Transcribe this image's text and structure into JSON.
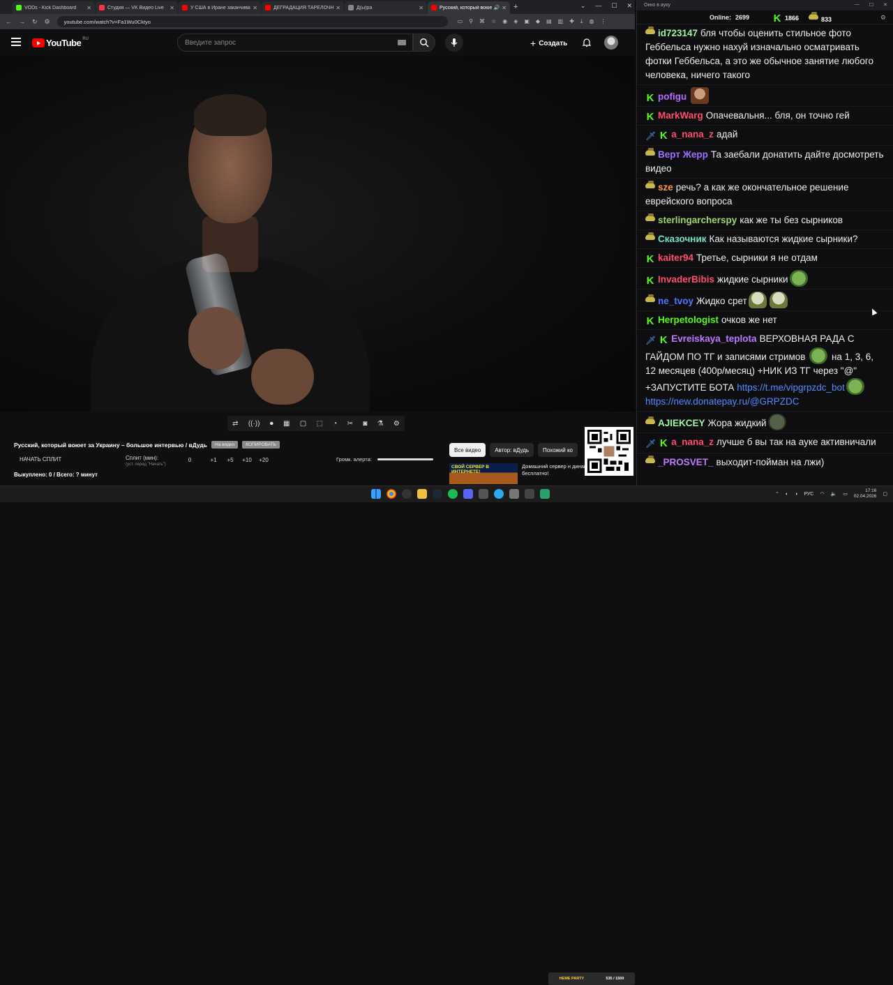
{
  "browser": {
    "tabs": [
      {
        "title": "VODs - Kick Dashboard",
        "color": "#53fc18"
      },
      {
        "title": "Студия — VK Видео Live",
        "color": "#ff3347"
      },
      {
        "title": "У США в Иране заканчивают",
        "color": "#ff0000"
      },
      {
        "title": "ДЕГРАДАЦИЯ ТАРЕЛОЧНИЦ",
        "color": "#ff0000"
      },
      {
        "title": "Д(ы)ра",
        "color": "#888888"
      },
      {
        "title": "Русский, который воюет з",
        "color": "#ff0000"
      }
    ],
    "url": "youtube.com/watch?v=Fa1Wu0Cktyo"
  },
  "youtube": {
    "logo": "YouTube",
    "region": "RU",
    "search_placeholder": "Введите запрос",
    "create_label": "Создать"
  },
  "player": {
    "toolbar_icons": [
      "loop-icon",
      "broadcast-icon",
      "screen-record-icon",
      "filmstrip-icon",
      "picture-in-picture-icon",
      "frame-icon",
      "speed-icon",
      "snippet-icon",
      "camera-icon",
      "flask-icon",
      "gear-icon"
    ]
  },
  "video": {
    "title": "Русский, который воюет за Украину – большое интервью / вДудь",
    "btn_on_video": "На видео",
    "btn_copy": "КОПИРОВАТЬ"
  },
  "split": {
    "start_label": "НАЧАТЬ СПЛИТ",
    "minutes_label": "Сплит (мин):",
    "minutes_sub": "(уст. перед \"Начать\")",
    "value": "0",
    "steps": [
      "+1",
      "+5",
      "+10",
      "+20"
    ],
    "bought": "Выкуплено: 0 / Всего: ? минут",
    "alert_volume_label": "Громк. алерта:"
  },
  "recommend": {
    "chips": [
      "Все видео",
      "Автор: вДудь",
      "Похожий ко"
    ],
    "thumb_text": "СВОЙ СЕРВЕР В ИНТЕРНЕТЕ!",
    "rec_text": "Домашний сервер н динамическом IP бесплатно!"
  },
  "chat": {
    "window_title": "Окно в ауку",
    "online_label": "Online:",
    "online_count": "2699",
    "kick_count": "1866",
    "gift_count": "833",
    "messages": [
      {
        "nick": "id723147",
        "color": "#9cf7a0",
        "badges": [
          "gift"
        ],
        "text": "бля чтобы оценить стильное фото Геббельса нужно нахуй изначально осматривать фотки Геббельса, а это же обычное занятие любого человека, ничего такого"
      },
      {
        "nick": "pofigu",
        "color": "#b76cff",
        "badges": [
          "kick"
        ],
        "text": "",
        "emotes": [
          "face-emote"
        ]
      },
      {
        "nick": "MarkWarg",
        "color": "#ff4d6d",
        "badges": [
          "kick"
        ],
        "text": "Опачевальня... бля, он точно гей"
      },
      {
        "nick": "a_nana_z",
        "color": "#ff4d6d",
        "badges": [
          "sword",
          "kick"
        ],
        "text": "адай"
      },
      {
        "nick": "Верт Жерр",
        "color": "#a070ff",
        "badges": [
          "gift"
        ],
        "text": "Та заебали донатить дайте досмотреть видео"
      },
      {
        "nick": "sze",
        "color": "#ff9a3c",
        "badges": [
          "gift"
        ],
        "text": "речь? а как же окончательное решение еврейского вопроса"
      },
      {
        "nick": "sterlingarcherspy",
        "color": "#9cd66a",
        "badges": [
          "gift"
        ],
        "text": "как же ты без сырников"
      },
      {
        "nick": "Сказочник",
        "color": "#6fe6c8",
        "badges": [
          "gift"
        ],
        "text": "Как называются жидкие сырники?"
      },
      {
        "nick": "kaiter94",
        "color": "#ff4d6d",
        "badges": [
          "kick"
        ],
        "text": "Третье, сырники я не отдам"
      },
      {
        "nick": "InvaderBibis",
        "color": "#ff4d6d",
        "badges": [
          "kick"
        ],
        "text": "жидкие сырники",
        "emotes": [
          "pepe-emote"
        ]
      },
      {
        "nick": "ne_tvoy",
        "color": "#4a78ff",
        "badges": [
          "gift"
        ],
        "text": "Жидко срет",
        "emotes": [
          "ghost-emote",
          "ghost-emote"
        ]
      },
      {
        "nick": "Herpetologist",
        "color": "#53fc18",
        "badges": [
          "kick"
        ],
        "text": "очков же нет"
      },
      {
        "nick": "Evreiskaya_teplota",
        "color": "#c078ff",
        "badges": [
          "sword",
          "kick"
        ],
        "text_before": "ВЕРХОВНАЯ РАДА С ГАЙДОМ ПО ТГ и записями стримов",
        "text_mid": "на 1, 3, 6, 12 месяцев (400р/месяц) +НИК ИЗ ТГ через \"@\" +ЗАПУСТИТЕ БОТА",
        "link1": "https://t.me/vipgrpzdc_bot",
        "link2": "https://new.donatepay.ru/@GRPZDC"
      },
      {
        "nick": "AJIEKCEY",
        "color": "#9cf7a0",
        "badges": [
          "gift"
        ],
        "text": "Жора жидкий",
        "emotes": [
          "stone-emote"
        ]
      },
      {
        "nick": "a_nana_z",
        "color": "#ff4d6d",
        "badges": [
          "sword",
          "kick"
        ],
        "text": "лучше б вы так на ауке активничали"
      },
      {
        "nick": "_PROSVET_",
        "color": "#c078ff",
        "badges": [
          "gift"
        ],
        "text": "выходит-пойман на лжи)"
      }
    ]
  },
  "taskbar": {
    "promo_left": "HEME PARTY",
    "promo_right": "535 / 1500",
    "lang": "РУС",
    "time": "17:16",
    "date": "02.04.2026"
  }
}
